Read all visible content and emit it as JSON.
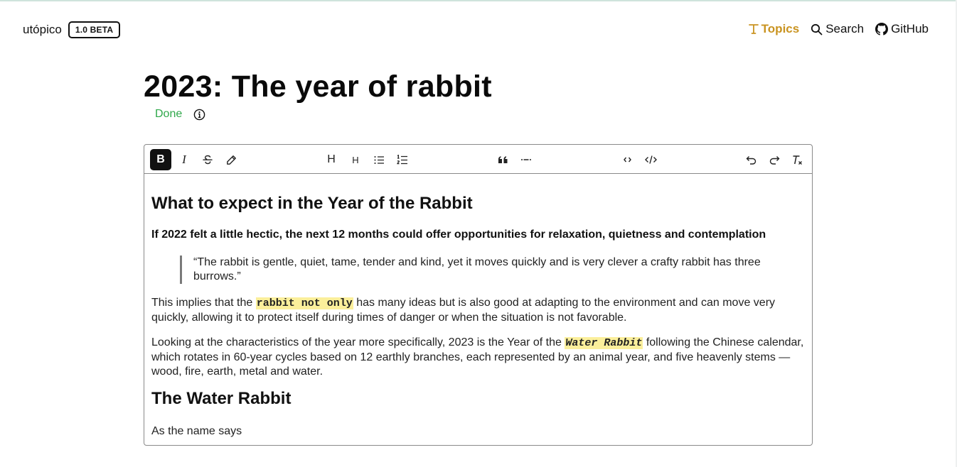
{
  "header": {
    "brand": "utópico",
    "badge": "1.0 BETA",
    "nav": [
      {
        "label": "Topics",
        "icon": "topics-icon",
        "active": true
      },
      {
        "label": "Search",
        "icon": "search-icon",
        "active": false
      },
      {
        "label": "GitHub",
        "icon": "github-icon",
        "active": false
      }
    ]
  },
  "page": {
    "title": "2023: The year of rabbit",
    "status": "Done"
  },
  "toolbar": {
    "buttons": [
      {
        "name": "bold",
        "label": "B",
        "active": true
      },
      {
        "name": "italic",
        "label": "I",
        "active": false
      },
      {
        "name": "strikethrough",
        "icon": "strikethrough-icon",
        "active": false
      },
      {
        "name": "highlight",
        "icon": "pencil-icon",
        "active": false
      },
      {
        "name": "heading-1",
        "label": "H",
        "active": false
      },
      {
        "name": "heading-2",
        "label": "H",
        "active": false
      },
      {
        "name": "bullet-list",
        "icon": "bullet-list-icon",
        "active": false
      },
      {
        "name": "ordered-list",
        "icon": "ordered-list-icon",
        "active": false
      },
      {
        "name": "blockquote",
        "icon": "quote-icon",
        "active": false
      },
      {
        "name": "horizontal-rule",
        "icon": "horizontal-rule-icon",
        "active": false
      },
      {
        "name": "code",
        "icon": "code-icon",
        "active": false
      },
      {
        "name": "code-block",
        "icon": "code-block-icon",
        "active": false
      },
      {
        "name": "undo",
        "icon": "undo-icon",
        "active": false
      },
      {
        "name": "redo",
        "icon": "redo-icon",
        "active": false
      },
      {
        "name": "clear-format",
        "icon": "clear-format-icon",
        "active": false
      }
    ]
  },
  "content": {
    "heading1": "What to expect in the Year of the Rabbit",
    "lead": "If 2022 felt a little hectic, the next 12 months could offer opportunities for relaxation, quietness and contemplation",
    "quote": "“The rabbit is gentle, quiet, tame, tender and kind, yet it moves quickly and is very clever a crafty rabbit has three burrows.”",
    "para1": {
      "before": "This implies that the ",
      "highlight": "rabbit not only",
      "after": " has many ideas but is also good at adapting to the environment and can move very quickly, allowing it to protect itself during times of danger or when the situation is not favorable."
    },
    "para2": {
      "before": "Looking at the characteristics of the year more specifically, 2023 is the Year of the ",
      "highlight": "Water Rabbit",
      "after": " following the Chinese calendar, which rotates in 60-year cycles based on 12 earthly branches, each represented by an animal year, and five heavenly stems — wood, fire, earth, metal and water."
    },
    "heading2": "The Water Rabbit",
    "para3": "As the name says"
  },
  "colors": {
    "accent": "#c99320",
    "status": "#2fa84a",
    "highlight": "#fbef9b"
  }
}
